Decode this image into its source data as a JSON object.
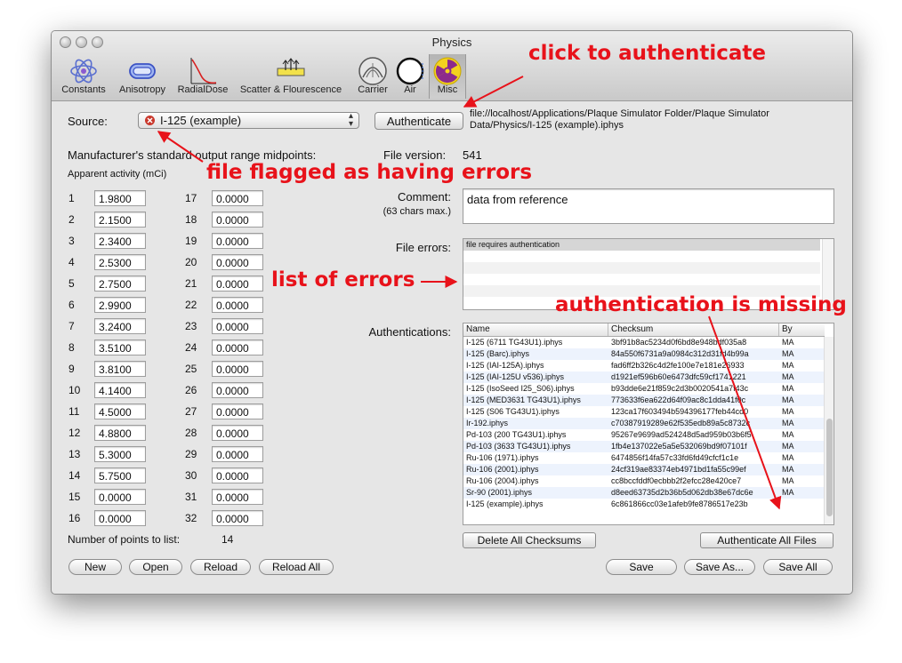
{
  "window": {
    "title": "Physics"
  },
  "toolbar": {
    "items": [
      {
        "label": "Constants",
        "icon": "atom-icon"
      },
      {
        "label": "Anisotropy",
        "icon": "anisotropy-icon"
      },
      {
        "label": "RadialDose",
        "icon": "radial-dose-curve-icon"
      },
      {
        "label": "Scatter & Flourescence",
        "icon": "scatter-icon"
      },
      {
        "label": "Carrier",
        "icon": "carrier-icon"
      },
      {
        "label": "Air",
        "icon": "air-icon"
      },
      {
        "label": "Misc",
        "icon": "radiation-icon",
        "selected": true
      }
    ]
  },
  "source": {
    "label": "Source:",
    "selected": "I-125 (example)",
    "authenticate_label": "Authenticate",
    "path": "file://localhost/Applications/Plaque Simulator Folder/Plaque Simulator Data/Physics/I-125 (example).iphys"
  },
  "manufacturer": {
    "heading": "Manufacturer's standard output range midpoints:",
    "subheading": "Apparent activity (mCi)",
    "rows_left": [
      {
        "n": "1",
        "v": "1.9800"
      },
      {
        "n": "2",
        "v": "2.1500"
      },
      {
        "n": "3",
        "v": "2.3400"
      },
      {
        "n": "4",
        "v": "2.5300"
      },
      {
        "n": "5",
        "v": "2.7500"
      },
      {
        "n": "6",
        "v": "2.9900"
      },
      {
        "n": "7",
        "v": "3.2400"
      },
      {
        "n": "8",
        "v": "3.5100"
      },
      {
        "n": "9",
        "v": "3.8100"
      },
      {
        "n": "10",
        "v": "4.1400"
      },
      {
        "n": "11",
        "v": "4.5000"
      },
      {
        "n": "12",
        "v": "4.8800"
      },
      {
        "n": "13",
        "v": "5.3000"
      },
      {
        "n": "14",
        "v": "5.7500"
      },
      {
        "n": "15",
        "v": "0.0000"
      },
      {
        "n": "16",
        "v": "0.0000"
      }
    ],
    "rows_right": [
      {
        "n": "17",
        "v": "0.0000"
      },
      {
        "n": "18",
        "v": "0.0000"
      },
      {
        "n": "19",
        "v": "0.0000"
      },
      {
        "n": "20",
        "v": "0.0000"
      },
      {
        "n": "21",
        "v": "0.0000"
      },
      {
        "n": "22",
        "v": "0.0000"
      },
      {
        "n": "23",
        "v": "0.0000"
      },
      {
        "n": "24",
        "v": "0.0000"
      },
      {
        "n": "25",
        "v": "0.0000"
      },
      {
        "n": "26",
        "v": "0.0000"
      },
      {
        "n": "27",
        "v": "0.0000"
      },
      {
        "n": "28",
        "v": "0.0000"
      },
      {
        "n": "29",
        "v": "0.0000"
      },
      {
        "n": "30",
        "v": "0.0000"
      },
      {
        "n": "31",
        "v": "0.0000"
      },
      {
        "n": "32",
        "v": "0.0000"
      }
    ],
    "points_label": "Number of points to list:",
    "points_value": "14"
  },
  "file": {
    "version_label": "File version:",
    "version_value": "541",
    "comment_label": "Comment:",
    "comment_hint": "(63 chars max.)",
    "comment_value": "data from reference",
    "errors_label": "File errors:",
    "errors": [
      "file requires authentication"
    ]
  },
  "authentications": {
    "label": "Authentications:",
    "columns": [
      "Name",
      "Checksum",
      "By"
    ],
    "rows": [
      [
        "I-125 (6711 TG43U1).iphys",
        "3bf91b8ac5234d0f6bd8e948bdf035a8",
        "MA"
      ],
      [
        "I-125 (Barc).iphys",
        "84a550f6731a9a0984c312d31fd4b99a",
        "MA"
      ],
      [
        "I-125 (IAI-125A).iphys",
        "fad6ff2b326c4d2fe100e7e181e26933",
        "MA"
      ],
      [
        "I-125 (IAI-125U v536).iphys",
        "d1921ef596b60e6473dfc59cf1741221",
        "MA"
      ],
      [
        "I-125 (IsoSeed I25_S06).iphys",
        "b93dde6e21f859c2d3b0020541a7f43c",
        "MA"
      ],
      [
        "I-125 (MED3631 TG43U1).iphys",
        "773633f6ea622d64f09ac8c1dda41f0c",
        "MA"
      ],
      [
        "I-125 (S06 TG43U1).iphys",
        "123ca17f603494b594396177feb44cd0",
        "MA"
      ],
      [
        "Ir-192.iphys",
        "c70387919289e62f535edb89a5c8732c",
        "MA"
      ],
      [
        "Pd-103 (200 TG43U1).iphys",
        "95267e9699ad524248d5ad959b03b6f5",
        "MA"
      ],
      [
        "Pd-103 (3633 TG43U1).iphys",
        "1fb4e137022e5a5e532069bd9f07101f",
        "MA"
      ],
      [
        "Ru-106 (1971).iphys",
        "6474856f14fa57c33fd6fd49cfcf1c1e",
        "MA"
      ],
      [
        "Ru-106 (2001).iphys",
        "24cf319ae83374eb4971bd1fa55c99ef",
        "MA"
      ],
      [
        "Ru-106 (2004).iphys",
        "cc8bccfddf0ecbbb2f2efcc28e420ce7",
        "MA"
      ],
      [
        "Sr-90 (2001).iphys",
        "d8eed63735d2b36b5d062db38e67dc6e",
        "MA"
      ],
      [
        "I-125 (example).iphys",
        "6c861866cc03e1afeb9fe8786517e23b",
        ""
      ]
    ],
    "delete_label": "Delete All Checksums",
    "auth_all_label": "Authenticate All Files"
  },
  "buttons": {
    "new": "New",
    "open": "Open",
    "reload": "Reload",
    "reload_all": "Reload All",
    "save": "Save",
    "save_as": "Save As...",
    "save_all": "Save All"
  },
  "annotations": {
    "click": "click to authenticate",
    "flagged": "file flagged as having errors",
    "errors": "list of errors",
    "missing": "authentication is missing"
  },
  "colors": {
    "annotation": "#e8121a",
    "error_badge": "#c9382c",
    "radiation": "#f3d21e"
  }
}
